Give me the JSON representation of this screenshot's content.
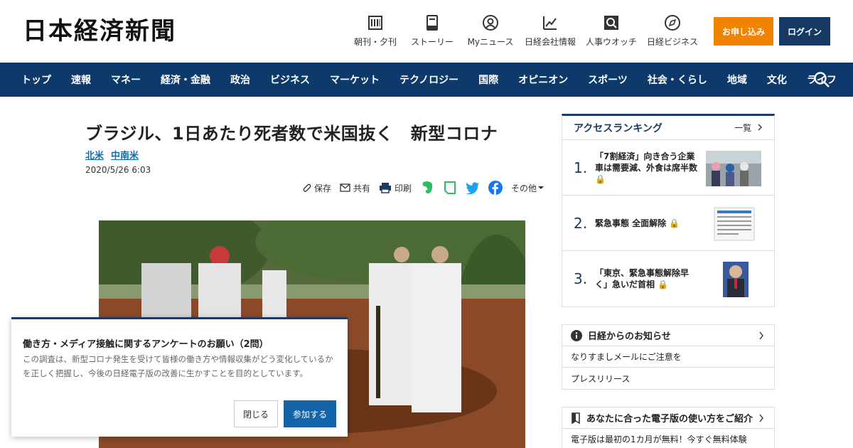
{
  "header": {
    "logo": "日本経済新聞",
    "nav": [
      {
        "label": "朝刊・夕刊",
        "icon": "newspaper-icon"
      },
      {
        "label": "ストーリー",
        "icon": "book-icon"
      },
      {
        "label": "Myニュース",
        "icon": "user-icon"
      },
      {
        "label": "日経会社情報",
        "icon": "chart-icon"
      },
      {
        "label": "人事ウオッチ",
        "icon": "person-search-icon"
      },
      {
        "label": "日経ビジネス",
        "icon": "compass-icon"
      }
    ],
    "subscribe_label": "お申し込み",
    "login_label": "ログイン"
  },
  "mainnav": {
    "items": [
      "トップ",
      "速報",
      "マネー",
      "経済・金融",
      "政治",
      "ビジネス",
      "マーケット",
      "テクノロジー",
      "国際",
      "オピニオン",
      "スポーツ",
      "社会・くらし",
      "地域",
      "文化",
      "ライフ"
    ]
  },
  "article": {
    "title": "ブラジル、1日あたり死者数で米国抜く　新型コロナ",
    "tags": [
      "北米",
      "中南米"
    ],
    "date": "2020/5/26 6:03",
    "share": {
      "save": "保存",
      "share": "共有",
      "print": "印刷",
      "other": "その他"
    }
  },
  "ranking": {
    "title": "アクセスランキング",
    "more": "一覧",
    "items": [
      {
        "rank": "1.",
        "text": "「7割経済」向き合う企業　車は需要減、外食は席半数"
      },
      {
        "rank": "2.",
        "text": "緊急事態 全面解除"
      },
      {
        "rank": "3.",
        "text": "「東京、緊急事態解除早く」急いだ首相"
      }
    ]
  },
  "notice": {
    "title": "日経からのお知らせ",
    "items": [
      "なりすましメールにご注意を",
      "プレスリリース"
    ]
  },
  "guide": {
    "title": "あなたに合った電子版の使い方をご紹介",
    "item": "電子版は最初の1カ月が無料！今すぐ無料体験"
  },
  "survey": {
    "title": "働き方・メディア接触に関するアンケートのお願い（2問）",
    "description": "この調査は、新型コロナ発生を受けて皆様の働き方や情報収集がどう変化しているかを正しく把握し、今後の日経電子版の改善に生かすことを目的としています。",
    "close_label": "閉じる",
    "join_label": "参加する"
  },
  "colors": {
    "nav_bg": "#0e3a6b",
    "subscribe": "#f08300",
    "login": "#163a64",
    "link": "#0b6fb3"
  }
}
